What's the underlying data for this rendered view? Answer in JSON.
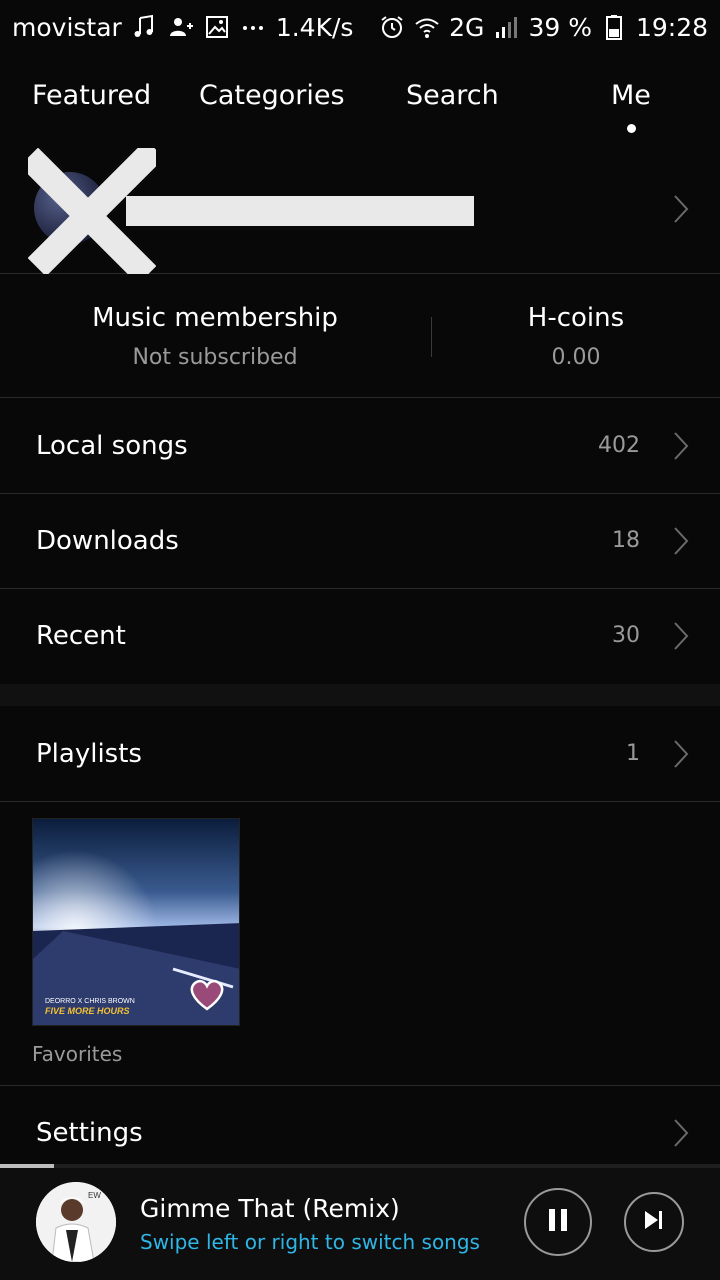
{
  "status_bar": {
    "carrier": "movistar",
    "speed": "1.4K/s",
    "network": "2G",
    "battery": "39 %",
    "time": "19:28",
    "icons": [
      "music-note-icon",
      "add-user-icon",
      "image-icon",
      "more-icon",
      "alarm-icon",
      "wifi-icon",
      "signal-icon",
      "battery-icon"
    ]
  },
  "tabs": [
    {
      "label": "Featured"
    },
    {
      "label": "Categories"
    },
    {
      "label": "Search"
    },
    {
      "label": "Me",
      "selected": true
    }
  ],
  "membership": {
    "title": "Music membership",
    "status": "Not subscribed",
    "coins_title": "H-coins",
    "coins_value": "0.00"
  },
  "rows": {
    "local": {
      "label": "Local songs",
      "count": "402"
    },
    "downloads": {
      "label": "Downloads",
      "count": "18"
    },
    "recent": {
      "label": "Recent",
      "count": "30"
    },
    "playlists": {
      "label": "Playlists",
      "count": "1"
    },
    "settings": {
      "label": "Settings"
    }
  },
  "playlist_card": {
    "name": "Favorites",
    "cover_artist": "DEORRO X CHRIS BROWN",
    "cover_title": "FIVE MORE HOURS"
  },
  "player": {
    "song": "Gimme That (Remix)",
    "hint": "Swipe left or right to switch songs",
    "progress": 0.075
  },
  "colors": {
    "background": "#080808",
    "accent": "#2fb6e6",
    "secondary_text": "#9a9a9a"
  }
}
